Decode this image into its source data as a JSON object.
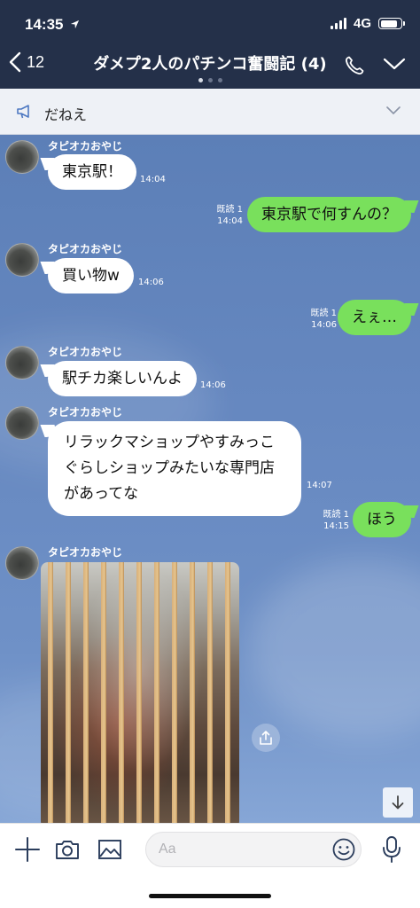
{
  "status_bar": {
    "time": "14:35",
    "network": "4G"
  },
  "header": {
    "back_count": "12",
    "title": "ダメプ2人のパチンコ奮闘記 (4)"
  },
  "announcement": {
    "text": "だねえ"
  },
  "messages": [
    {
      "sender": "タピオカおやじ",
      "text": "東京駅！",
      "time": "14:04"
    },
    {
      "text": "東京駅で何すんの？",
      "read": "既読 1",
      "time": "14:04"
    },
    {
      "sender": "タピオカおやじ",
      "text": "買い物w",
      "time": "14:06"
    },
    {
      "text": "えぇ…",
      "read": "既読 1",
      "time": "14:06"
    },
    {
      "sender": "タピオカおやじ",
      "text": "駅チカ楽しいんよ",
      "time": "14:06"
    },
    {
      "sender": "タピオカおやじ",
      "text": "リラックマショップやすみっこぐらしショップみたいな専門店があってな",
      "time": "14:07"
    },
    {
      "text": "ほう",
      "read": "既読 1",
      "time": "14:15"
    },
    {
      "sender": "タピオカおやじ",
      "type": "image"
    }
  ],
  "input": {
    "placeholder": "Aa"
  },
  "colors": {
    "header_bg": "#243049",
    "outgoing_bubble": "#79e05c",
    "incoming_bubble": "#ffffff",
    "chat_bg": "#6688c0"
  },
  "icons": [
    "location-arrow-icon",
    "signal-icon",
    "battery-icon",
    "back-chevron-icon",
    "phone-icon",
    "chevron-down-icon",
    "megaphone-icon",
    "share-icon",
    "arrow-down-icon",
    "plus-icon",
    "camera-icon",
    "image-icon",
    "emoji-icon",
    "microphone-icon"
  ]
}
